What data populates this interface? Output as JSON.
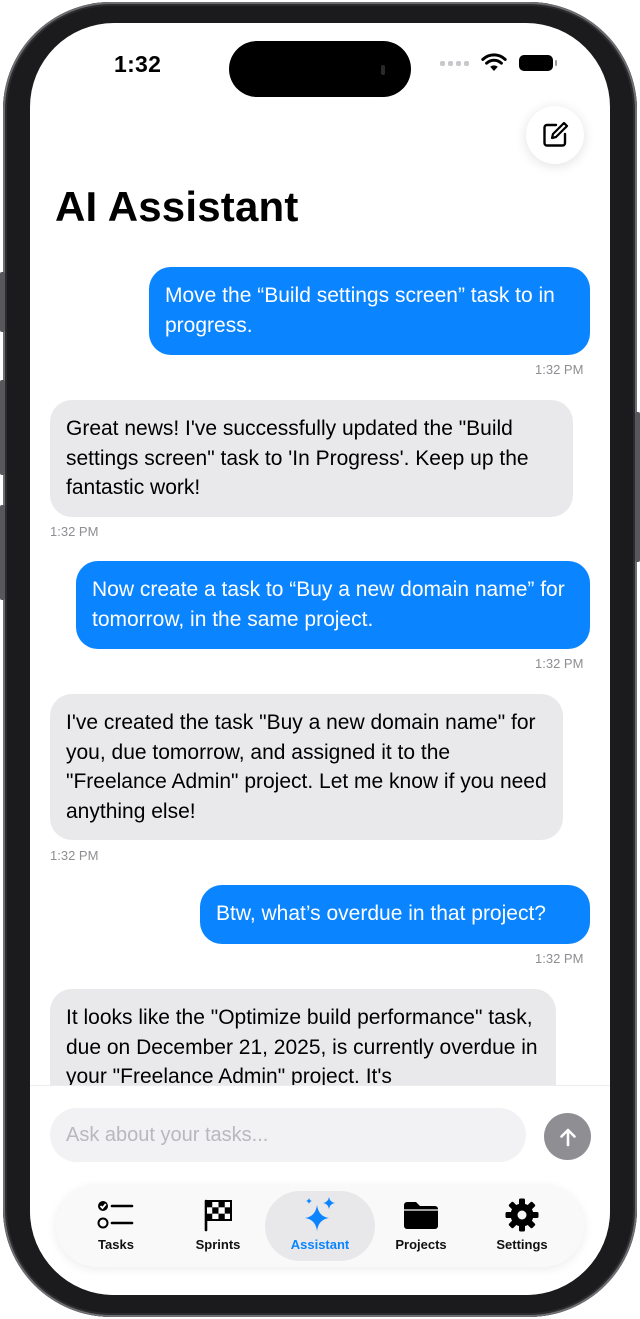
{
  "status_bar": {
    "time": "1:32"
  },
  "header": {
    "title": "AI Assistant"
  },
  "messages": [
    {
      "role": "user",
      "text": "Move the “Build settings screen” task to in progress.",
      "time": "1:32 PM"
    },
    {
      "role": "assistant",
      "text": "Great news! I've successfully updated the \"Build settings screen\" task to 'In Progress'. Keep up the fantastic work!",
      "time": "1:32 PM"
    },
    {
      "role": "user",
      "text": "Now create a task to “Buy a new domain name” for tomorrow, in the same project.",
      "time": "1:32 PM"
    },
    {
      "role": "assistant",
      "text": "I've created the task \"Buy a new domain name\" for you, due tomorrow, and assigned it to the \"Freelance Admin\" project. Let me know if you need anything else!",
      "time": "1:32 PM"
    },
    {
      "role": "user",
      "text": "Btw, what’s overdue in that project?",
      "time": "1:32 PM"
    },
    {
      "role": "assistant",
      "text": "It looks like the \"Optimize build performance\" task, due on December 21, 2025, is currently overdue in your \"Freelance Admin\" project. It's"
    }
  ],
  "composer": {
    "placeholder": "Ask about your tasks..."
  },
  "tabs": [
    {
      "label": "Tasks",
      "icon": "checklist-icon"
    },
    {
      "label": "Sprints",
      "icon": "checkered-flag-icon"
    },
    {
      "label": "Assistant",
      "icon": "sparkles-icon",
      "active": true
    },
    {
      "label": "Projects",
      "icon": "folder-icon"
    },
    {
      "label": "Settings",
      "icon": "gear-icon"
    }
  ],
  "colors": {
    "accent": "#0a84ff",
    "incoming_bubble": "#e9e9eb",
    "send_button": "#8e8e93"
  }
}
